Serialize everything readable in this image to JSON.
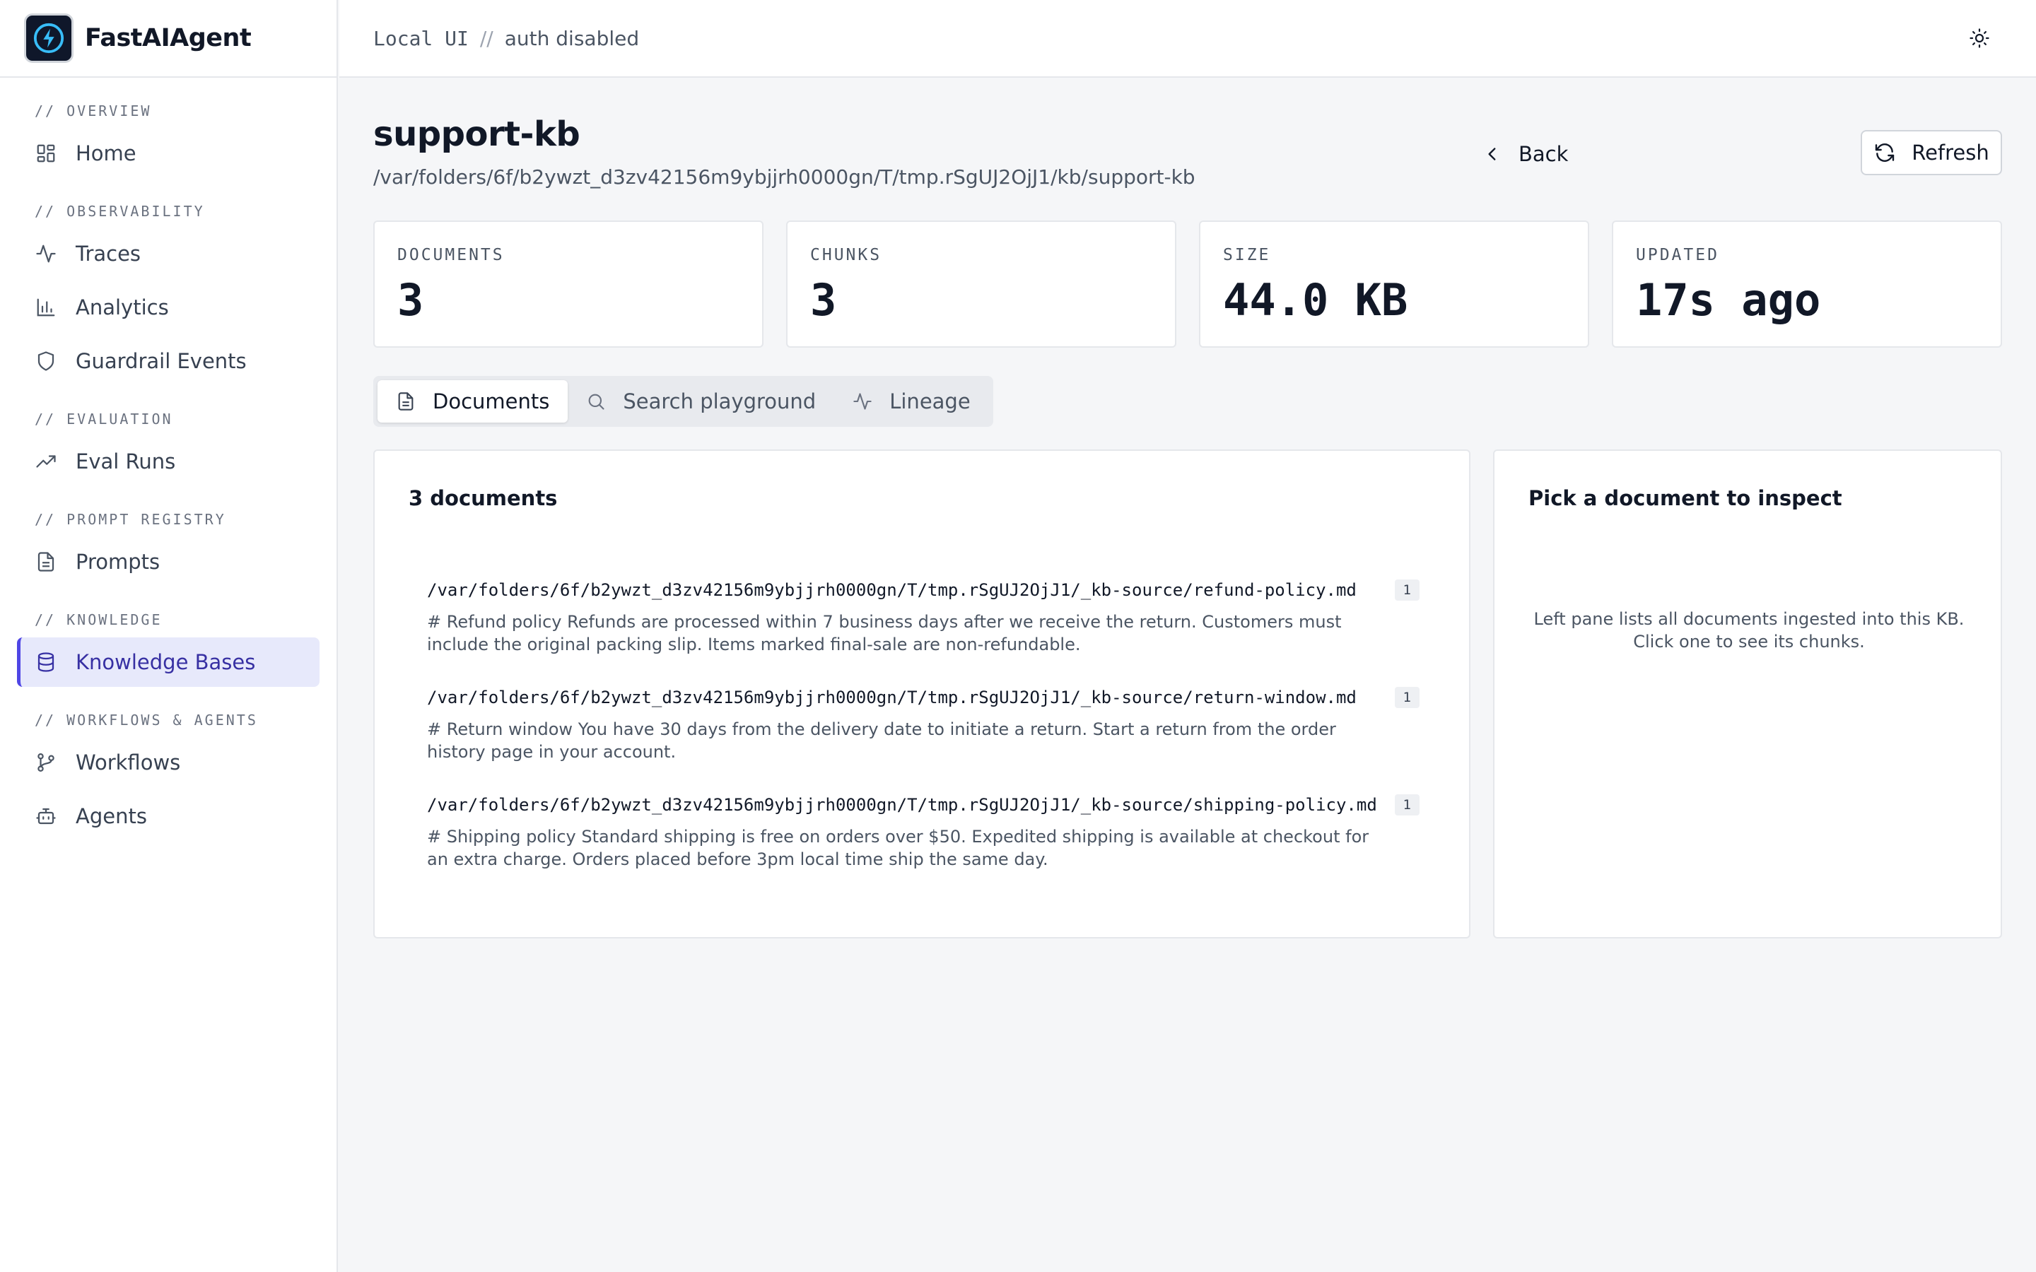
{
  "app": {
    "name": "FastAIAgent",
    "logo_icon": "lightning-bolt-icon",
    "brand_color": "#0f172a",
    "accent_color": "#4f46e5"
  },
  "topbar": {
    "env": "Local UI",
    "separator": "//",
    "auth": "auth disabled",
    "theme_icon": "sun-icon"
  },
  "sidebar": {
    "groups": [
      {
        "heading": "// OVERVIEW",
        "items": [
          {
            "label": "Home",
            "icon": "grid-icon"
          }
        ]
      },
      {
        "heading": "// OBSERVABILITY",
        "items": [
          {
            "label": "Traces",
            "icon": "activity-icon"
          },
          {
            "label": "Analytics",
            "icon": "bar-chart-icon"
          },
          {
            "label": "Guardrail Events",
            "icon": "shield-icon"
          }
        ]
      },
      {
        "heading": "// EVALUATION",
        "items": [
          {
            "label": "Eval Runs",
            "icon": "trending-up-icon"
          }
        ]
      },
      {
        "heading": "// PROMPT REGISTRY",
        "items": [
          {
            "label": "Prompts",
            "icon": "file-text-icon"
          }
        ]
      },
      {
        "heading": "// KNOWLEDGE",
        "items": [
          {
            "label": "Knowledge Bases",
            "icon": "database-icon",
            "active": true
          }
        ]
      },
      {
        "heading": "// WORKFLOWS & AGENTS",
        "items": [
          {
            "label": "Workflows",
            "icon": "git-branch-icon"
          },
          {
            "label": "Agents",
            "icon": "bot-icon"
          }
        ]
      }
    ]
  },
  "page": {
    "title": "support-kb",
    "path": "/var/folders/6f/b2ywzt_d3zv42156m9ybjjrh0000gn/T/tmp.rSgUJ2OjJ1/kb/support-kb",
    "back_label": "Back",
    "refresh_label": "Refresh"
  },
  "stats": [
    {
      "label": "DOCUMENTS",
      "value": "3"
    },
    {
      "label": "CHUNKS",
      "value": "3"
    },
    {
      "label": "SIZE",
      "value": "44.0 KB"
    },
    {
      "label": "UPDATED",
      "value": "17s ago"
    }
  ],
  "tabs": [
    {
      "label": "Documents",
      "icon": "file-text-icon",
      "active": true
    },
    {
      "label": "Search playground",
      "icon": "search-icon"
    },
    {
      "label": "Lineage",
      "icon": "activity-icon"
    }
  ],
  "documents": {
    "title": "3 documents",
    "items": [
      {
        "path": "/var/folders/6f/b2ywzt_d3zv42156m9ybjjrh0000gn/T/tmp.rSgUJ2OjJ1/_kb-source/refund-policy.md",
        "chunks": "1",
        "snippet": "# Refund policy Refunds are processed within 7 business days after we receive the return. Customers must include the original packing slip. Items marked final-sale are non-refundable."
      },
      {
        "path": "/var/folders/6f/b2ywzt_d3zv42156m9ybjjrh0000gn/T/tmp.rSgUJ2OjJ1/_kb-source/return-window.md",
        "chunks": "1",
        "snippet": "# Return window You have 30 days from the delivery date to initiate a return. Start a return from the order history page in your account."
      },
      {
        "path": "/var/folders/6f/b2ywzt_d3zv42156m9ybjjrh0000gn/T/tmp.rSgUJ2OjJ1/_kb-source/shipping-policy.md",
        "chunks": "1",
        "snippet": "# Shipping policy Standard shipping is free on orders over $50. Expedited shipping is available at checkout for an extra charge. Orders placed before 3pm local time ship the same day."
      }
    ]
  },
  "inspector": {
    "title": "Pick a document to inspect",
    "hint": "Left pane lists all documents ingested into this KB. Click one to see its chunks."
  }
}
